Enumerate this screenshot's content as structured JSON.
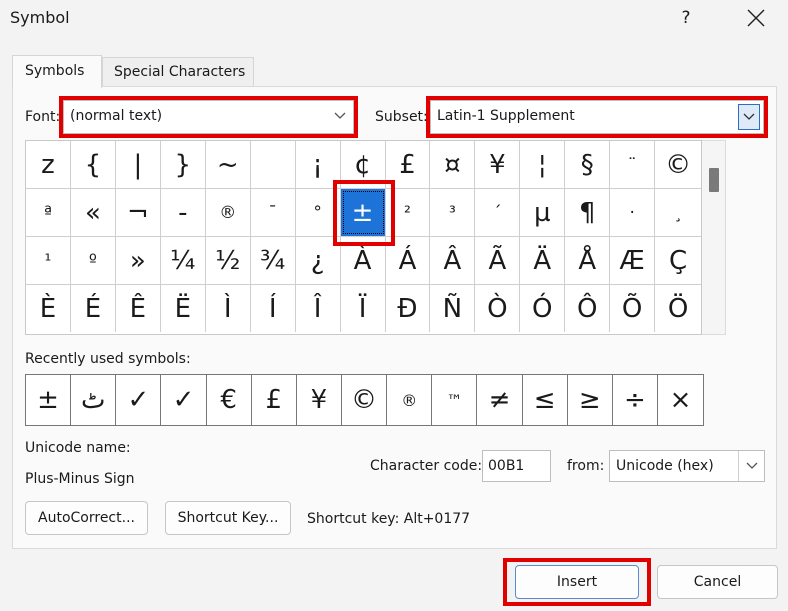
{
  "window": {
    "title": "Symbol",
    "help_label": "?"
  },
  "tabs": [
    {
      "label": "Symbols"
    },
    {
      "label": "Special Characters"
    }
  ],
  "font": {
    "label": "Font:",
    "value": "(normal text)"
  },
  "subset": {
    "label": "Subset:",
    "value": "Latin-1 Supplement"
  },
  "grid": {
    "rows": [
      [
        "z",
        "{",
        "|",
        "}",
        "~",
        "",
        "¡",
        "¢",
        "£",
        "¤",
        "¥",
        "¦",
        "§",
        "¨",
        "©"
      ],
      [
        "ª",
        "«",
        "¬",
        "-",
        "®",
        "¯",
        "°",
        "±",
        "²",
        "³",
        "´",
        "µ",
        "¶",
        "·",
        "¸"
      ],
      [
        "¹",
        "º",
        "»",
        "¼",
        "½",
        "¾",
        "¿",
        "À",
        "Á",
        "Â",
        "Ã",
        "Ä",
        "Å",
        "Æ",
        "Ç"
      ],
      [
        "È",
        "É",
        "Ê",
        "Ë",
        "Ì",
        "Í",
        "Î",
        "Ï",
        "Ð",
        "Ñ",
        "Ò",
        "Ó",
        "Ô",
        "Õ",
        "Ö"
      ]
    ],
    "selected_symbol": "±"
  },
  "recent": {
    "label": "Recently used symbols:",
    "symbols": [
      "±",
      "ٹ",
      "✓",
      "✓",
      "€",
      "£",
      "¥",
      "©",
      "®",
      "™",
      "≠",
      "≤",
      "≥",
      "÷",
      "×"
    ]
  },
  "unicode": {
    "name_label": "Unicode name:",
    "name_value": "Plus-Minus Sign"
  },
  "char_code": {
    "label": "Character code:",
    "value": "00B1"
  },
  "from": {
    "label": "from:",
    "value": "Unicode (hex)"
  },
  "buttons": {
    "autocorrect": "AutoCorrect...",
    "shortcut_key": "Shortcut Key...",
    "insert": "Insert",
    "cancel": "Cancel"
  },
  "shortcut_text": "Shortcut key: Alt+0177",
  "colors": {
    "highlight": "#e00000",
    "selection": "#1e73d8"
  }
}
